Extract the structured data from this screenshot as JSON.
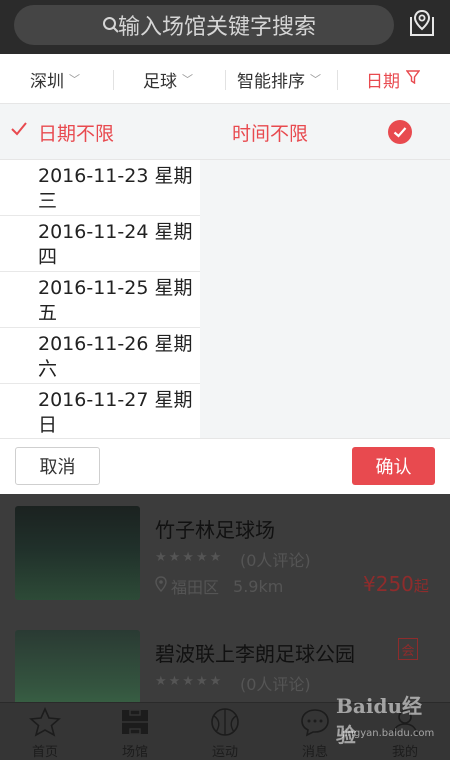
{
  "search": {
    "placeholder": "输入场馆关键字搜索"
  },
  "filters": [
    {
      "label": "深圳"
    },
    {
      "label": "足球"
    },
    {
      "label": "智能排序"
    },
    {
      "label": "日期"
    }
  ],
  "date_panel": {
    "all_label": "日期不限",
    "dates": [
      "2016-11-23  星期三",
      "2016-11-24  星期四",
      "2016-11-25  星期五",
      "2016-11-26  星期六",
      "2016-11-27  星期日"
    ],
    "time_all_label": "时间不限"
  },
  "actions": {
    "cancel": "取消",
    "confirm": "确认"
  },
  "venues": [
    {
      "name": "竹子林足球场",
      "rating_stars": "★★★★★",
      "reviews": "(0人评论)",
      "district": "福田区",
      "distance": "5.9km",
      "price": "¥250",
      "price_suffix": "起"
    },
    {
      "name": "碧波联上李朗足球公园",
      "badge": "会",
      "rating_stars": "★★★★★",
      "reviews": "(0人评论)"
    }
  ],
  "tabs": [
    {
      "label": "首页",
      "icon": "star-icon"
    },
    {
      "label": "场馆",
      "icon": "stadium-icon"
    },
    {
      "label": "运动",
      "icon": "ball-icon"
    },
    {
      "label": "消息",
      "icon": "chat-icon"
    },
    {
      "label": "我的",
      "icon": "user-icon"
    }
  ],
  "watermark": {
    "main": "Baidu经验",
    "sub": "jingyan.baidu.com"
  },
  "colors": {
    "accent": "#e84a4f",
    "header_bg": "#2b2b2b",
    "panel_bg": "#f3f5f6"
  }
}
